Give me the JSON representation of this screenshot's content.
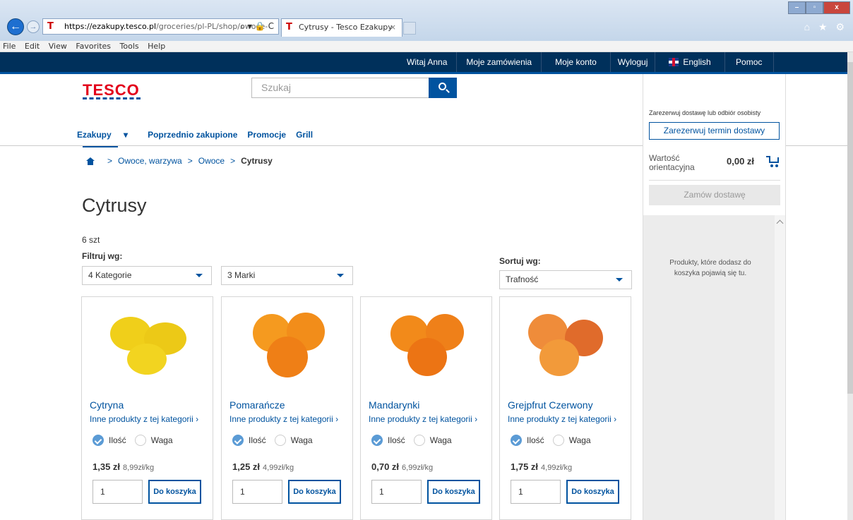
{
  "browser": {
    "url_host": "https://ezakupy.tesco.pl",
    "url_path": "/groceries/pl-PL/shop/owoce-",
    "url_controls": "⌕ ▾ 🔒 C",
    "tab_title": "Cytrusy - Tesco Ezakupy",
    "tab_close": "×",
    "favicon": "T",
    "menu": [
      "File",
      "Edit",
      "View",
      "Favorites",
      "Tools",
      "Help"
    ],
    "window_controls": [
      "–",
      "▫",
      "x"
    ],
    "right_icons": "⌂ ★ ⚙"
  },
  "topbar": {
    "greeting": "Witaj Anna",
    "orders": "Moje zamówienia",
    "account": "Moje konto",
    "logout": "Wyloguj",
    "language": "English",
    "help": "Pomoc"
  },
  "header": {
    "logo": "TESCO",
    "search_placeholder": "Szukaj",
    "nav": [
      "Ezakupy",
      "Poprzednio zakupione",
      "Promocje",
      "Grill"
    ],
    "nav_caret": "▾"
  },
  "breadcrumb": {
    "items": [
      "Owoce, warzywa",
      "Owoce"
    ],
    "current": "Cytrusy",
    "separator": ">"
  },
  "page": {
    "title": "Cytrusy",
    "count": "6 szt",
    "filter_label": "Filtruj wg:",
    "filters": [
      "4 Kategorie",
      "3 Marki"
    ],
    "sort_label": "Sortuj wg:",
    "sort_value": "Trafność"
  },
  "sidebar": {
    "reserve_text": "Zarezerwuj dostawę lub odbiór osobisty",
    "reserve_button": "Zarezerwuj termin dostawy",
    "value_label": "Wartość orientacyjna",
    "value": "0,00 zł",
    "order_button": "Zamów dostawę",
    "empty_text": "Produkty, które dodasz do koszyka pojawią się tu."
  },
  "products": [
    {
      "name": "Cytryna",
      "link": "Inne produkty z tej kategorii",
      "opt_qty": "Ilość",
      "opt_weight": "Waga",
      "price": "1,35 zł",
      "unit_price": "8,99zł/kg",
      "qty": "1",
      "add": "Do koszyka",
      "color": "#f2d21b"
    },
    {
      "name": "Pomarańcze",
      "link": "Inne produkty z tej kategorii",
      "opt_qty": "Ilość",
      "opt_weight": "Waga",
      "price": "1,25 zł",
      "unit_price": "4,99zł/kg",
      "qty": "1",
      "add": "Do koszyka",
      "color": "#f28a1a"
    },
    {
      "name": "Mandarynki",
      "link": "Inne produkty z tej kategorii",
      "opt_qty": "Ilość",
      "opt_weight": "Waga",
      "price": "0,70 zł",
      "unit_price": "6,99zł/kg",
      "qty": "1",
      "add": "Do koszyka",
      "color": "#f07a18"
    },
    {
      "name": "Grejpfrut Czerwony",
      "link": "Inne produkty z tej kategorii",
      "opt_qty": "Ilość",
      "opt_weight": "Waga",
      "price": "1,75 zł",
      "unit_price": "4,99zł/kg",
      "qty": "1",
      "add": "Do koszyka",
      "color": "#e8722a"
    }
  ],
  "link_arrow": "›",
  "colors": {
    "brand_blue": "#00539f",
    "topbar": "#00305b",
    "tesco_red": "#e3001b"
  }
}
